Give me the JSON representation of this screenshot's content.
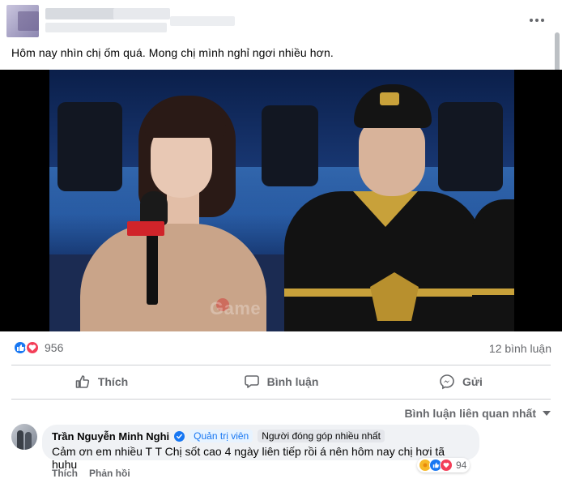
{
  "post": {
    "text": "Hôm nay nhìn chị ốm quá. Mong chị mình nghỉ ngơi nhiều hơn."
  },
  "media": {
    "watermark_text": "Game"
  },
  "stats": {
    "reactions_count": "956",
    "reaction_types": [
      "like-icon",
      "love-icon"
    ],
    "comments_count": "12 bình luận"
  },
  "actions": {
    "like_label": "Thích",
    "comment_label": "Bình luận",
    "send_label": "Gửi"
  },
  "comments": {
    "sort_label": "Bình luận liên quan nhất",
    "top": {
      "author": "Trần Nguyễn Minh Nghi",
      "badges": [
        "Quản trị viên",
        "Người đóng góp nhiều nhất"
      ],
      "text": "Cảm ơn em nhiều T T Chị sốt cao 4 ngày liên tiếp rồi á nên hôm nay chị hơi tã huhu",
      "reactions_count": "94",
      "reaction_types": [
        "care-icon",
        "like-icon",
        "love-icon"
      ],
      "like_action": "Thích",
      "reply_action": "Phản hồi"
    }
  },
  "colors": {
    "accent": "#1877f2",
    "love": "#f33e58",
    "secondary_text": "#65676b"
  }
}
